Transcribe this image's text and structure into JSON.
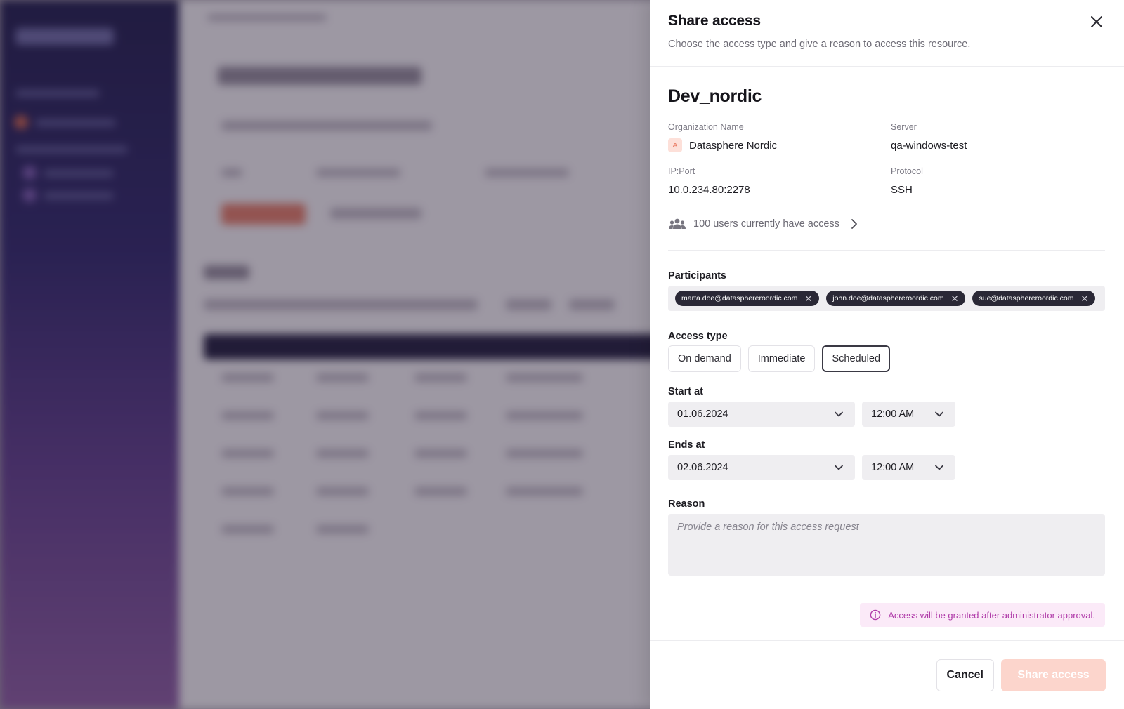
{
  "drawer": {
    "title": "Share access",
    "subtitle": "Choose the access type and give a reason to access this resource."
  },
  "resource": {
    "name": "Dev_nordic",
    "organization": {
      "label": "Organization Name",
      "value": "Datasphere Nordic",
      "avatar_letter": "A"
    },
    "server": {
      "label": "Server",
      "value": "qa-windows-test"
    },
    "ip_port": {
      "label": "IP:Port",
      "value": "10.0.234.80:2278"
    },
    "protocol": {
      "label": "Protocol",
      "value": "SSH"
    },
    "users_access": "100 users currently have access"
  },
  "participants": {
    "label": "Participants",
    "chips": [
      "marta.doe@datasphereroordic.com",
      "john.doe@datasphereroordic.com",
      "sue@datasphereroordic.com"
    ]
  },
  "access_type": {
    "label": "Access type",
    "options": [
      "On demand",
      "Immediate",
      "Scheduled"
    ],
    "selected": "Scheduled"
  },
  "start": {
    "label": "Start at",
    "date": "01.06.2024",
    "time": "12:00 AM"
  },
  "ends": {
    "label": "Ends at",
    "date": "02.06.2024",
    "time": "12:00 AM"
  },
  "reason": {
    "label": "Reason",
    "placeholder": "Provide a reason for this access request",
    "value": ""
  },
  "notice": "Access will be granted after administrator approval.",
  "footer": {
    "cancel": "Cancel",
    "submit": "Share access"
  },
  "colors": {
    "accent_disabled": "#fcd5cc",
    "notice_text": "#b03ba9",
    "notice_bg": "#fbeaf8",
    "chip_bg": "#2a2836",
    "sidebar_top": "#1c1a4a",
    "sidebar_bottom": "#8a5aa0"
  }
}
